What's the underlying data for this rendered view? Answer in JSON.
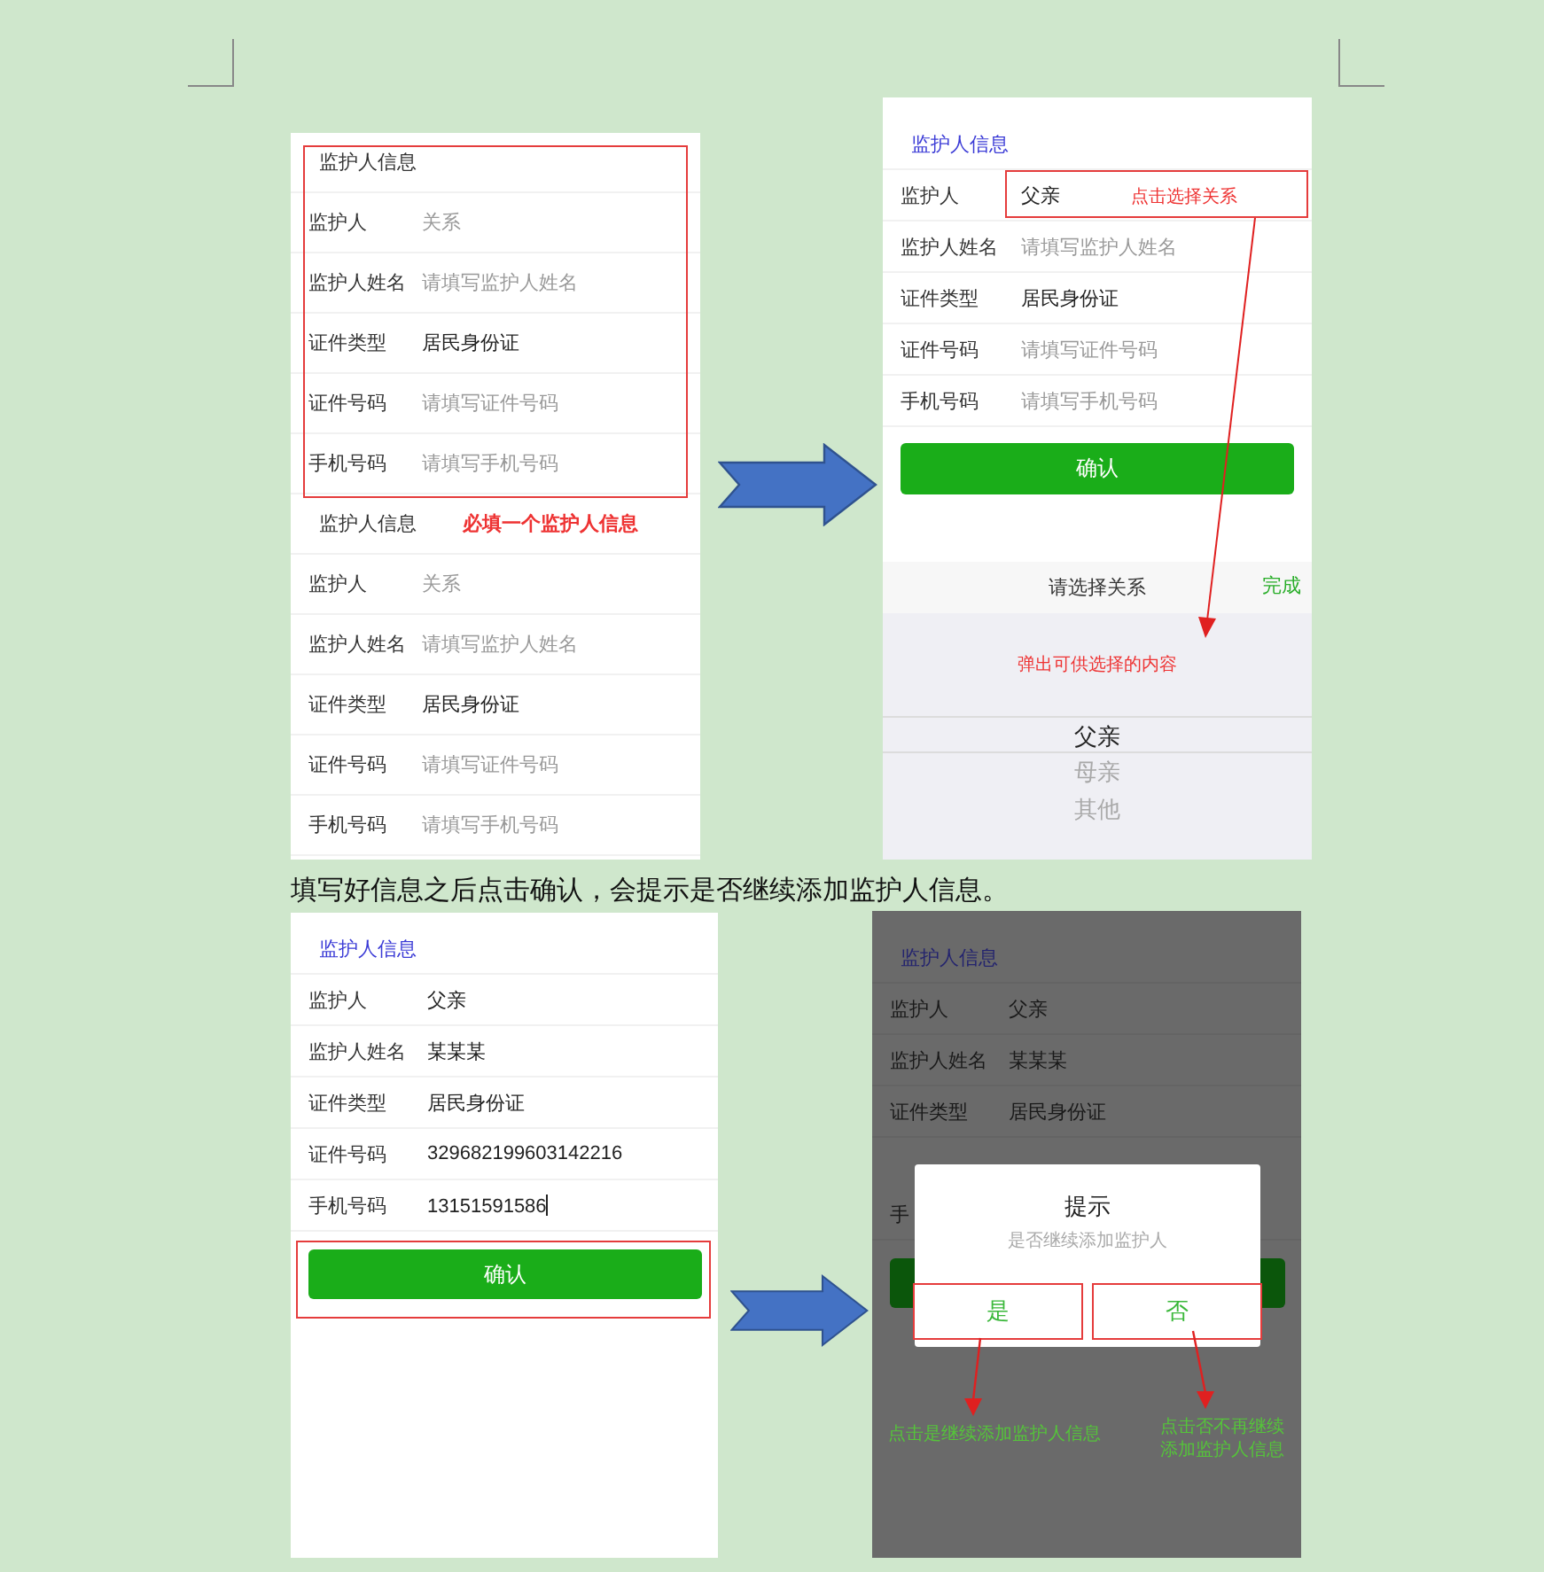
{
  "screens": [
    {
      "kind": "form",
      "sections": [
        {
          "title": "监护人信息",
          "boxed": true,
          "fields": [
            {
              "label": "监护人",
              "placeholder": "关系"
            },
            {
              "label": "监护人姓名",
              "placeholder": "请填写监护人姓名"
            },
            {
              "label": "证件类型",
              "value": "居民身份证"
            },
            {
              "label": "证件号码",
              "placeholder": "请填写证件号码"
            },
            {
              "label": "手机号码",
              "placeholder": "请填写手机号码"
            }
          ]
        },
        {
          "title": "监护人信息",
          "boxed": false,
          "note": "必填一个监护人信息",
          "fields": [
            {
              "label": "监护人",
              "placeholder": "关系"
            },
            {
              "label": "监护人姓名",
              "placeholder": "请填写监护人姓名"
            },
            {
              "label": "证件类型",
              "value": "居民身份证"
            },
            {
              "label": "证件号码",
              "placeholder": "请填写证件号码"
            },
            {
              "label": "手机号码",
              "placeholder": "请填写手机号码"
            }
          ]
        }
      ]
    },
    {
      "kind": "picker",
      "sections": [
        {
          "title": "监护人信息",
          "fields": [
            {
              "label": "监护人",
              "value": "父亲",
              "boxed": true,
              "note": "点击选择关系"
            },
            {
              "label": "监护人姓名",
              "placeholder": "请填写监护人姓名",
              "boxed": false
            },
            {
              "label": "证件类型",
              "value": "居民身份证",
              "boxed": false
            },
            {
              "label": "证件号码",
              "placeholder": "请填写证件号码",
              "boxed": false
            },
            {
              "label": "手机号码",
              "placeholder": "请填写手机号码",
              "boxed": false
            }
          ]
        }
      ],
      "button": {
        "label": "确认"
      },
      "picker": {
        "title": "请选择关系",
        "done": "完成",
        "note": "弹出可供选择的内容",
        "options": [
          {
            "label": "父亲",
            "selected": true
          },
          {
            "label": "母亲",
            "selected": false
          },
          {
            "label": "其他",
            "selected": false
          }
        ]
      }
    },
    {
      "kind": "filled",
      "sections": [
        {
          "title": "监护人信息",
          "fields": [
            {
              "label": "监护人",
              "value": "父亲",
              "focused": false
            },
            {
              "label": "监护人姓名",
              "value": "某某某",
              "focused": false
            },
            {
              "label": "证件类型",
              "value": "居民身份证",
              "focused": false
            },
            {
              "label": "证件号码",
              "value": "329682199603142216",
              "focused": false
            },
            {
              "label": "手机号码",
              "value": "13151591586",
              "focused": true
            }
          ]
        }
      ],
      "button": {
        "label": "确认",
        "boxed": true
      }
    },
    {
      "kind": "dialog",
      "sections": [
        {
          "title": "监护人信息",
          "fields": [
            {
              "label": "监护人",
              "value": "父亲"
            },
            {
              "label": "监护人姓名",
              "value": "某某某"
            },
            {
              "label": "证件类型",
              "value": "居民身份证"
            },
            {
              "label": "手"
            }
          ]
        }
      ],
      "dialog": {
        "title": "提示",
        "message": "是否继续添加监护人",
        "actions": [
          {
            "label": "是",
            "boxed": true,
            "note": "点击是继续添加监护人信息"
          },
          {
            "label": "否",
            "boxed": true,
            "note": "点击否不再继续添加监护人信息"
          }
        ]
      }
    }
  ],
  "caption": "填写好信息之后点击确认，会提示是否继续添加监护人信息。"
}
